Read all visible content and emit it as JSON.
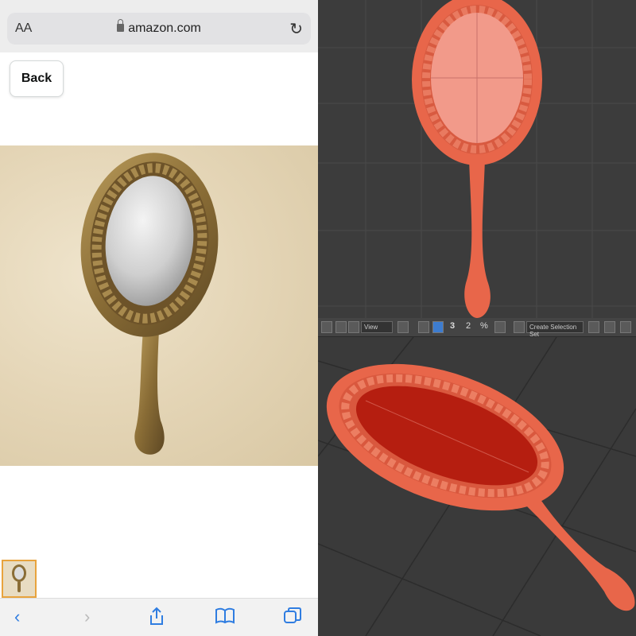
{
  "browser": {
    "text_size_label": "AA",
    "url": "amazon.com",
    "back_label": "Back"
  },
  "icons": {
    "lock": "lock-icon",
    "reload": "reload-icon",
    "back": "chevron-left-icon",
    "forward": "chevron-right-icon",
    "share": "share-icon",
    "bookmarks": "book-icon",
    "tabs": "tabs-icon"
  },
  "viewport": {
    "view_dropdown": "View",
    "selection_set": "Create Selection Set",
    "toolbar_numbers": [
      "3",
      "2",
      "%"
    ]
  },
  "colors": {
    "accent": "#2f7de1",
    "thumb_border": "#e8a33d",
    "model": "#e8664a",
    "viewport_bg": "#3a3a3a"
  }
}
